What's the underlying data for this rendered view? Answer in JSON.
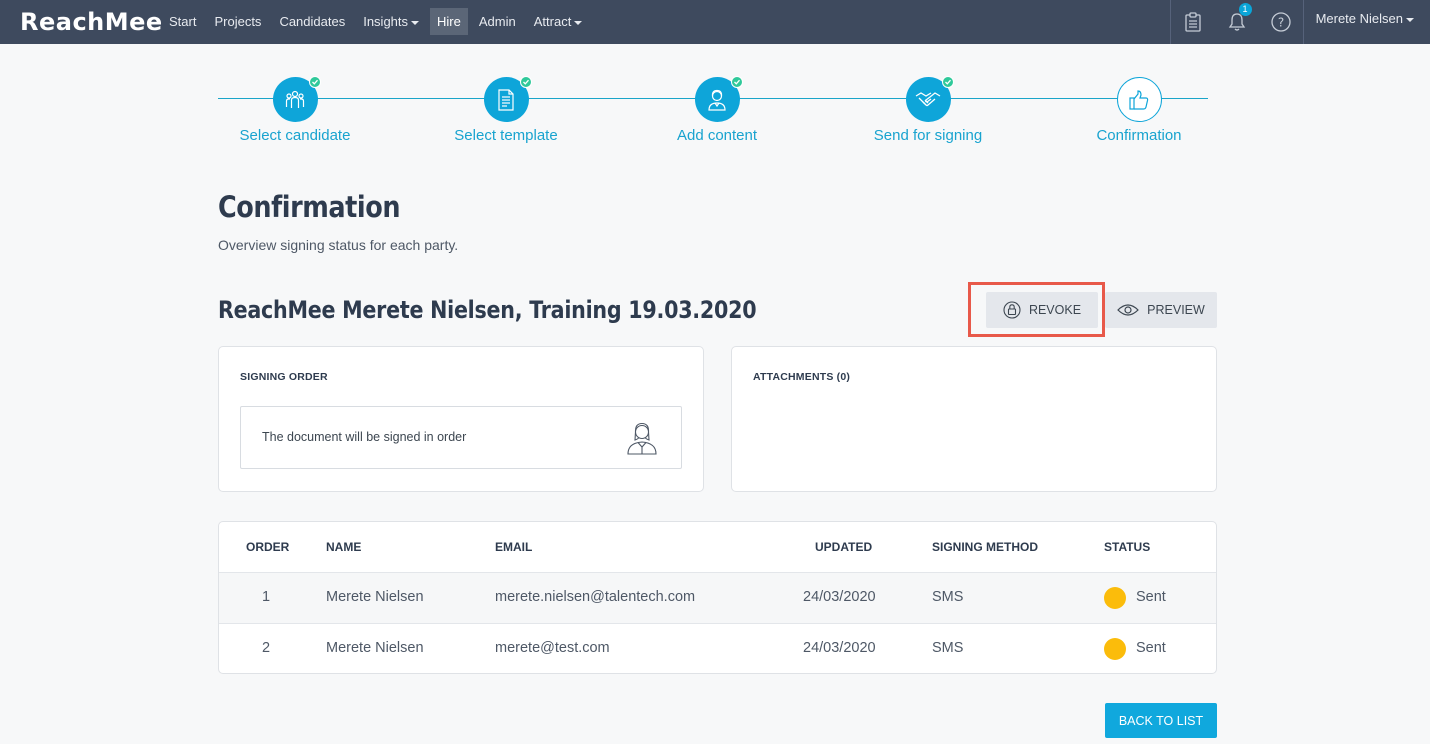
{
  "navbar": {
    "logo": "ReachMee",
    "items": [
      {
        "label": "Start",
        "dropdown": false,
        "active": false
      },
      {
        "label": "Projects",
        "dropdown": false,
        "active": false
      },
      {
        "label": "Candidates",
        "dropdown": false,
        "active": false
      },
      {
        "label": "Insights",
        "dropdown": true,
        "active": false
      },
      {
        "label": "Hire",
        "dropdown": false,
        "active": true
      },
      {
        "label": "Admin",
        "dropdown": false,
        "active": false
      },
      {
        "label": "Attract",
        "dropdown": true,
        "active": false
      }
    ],
    "notification_count": "1",
    "user_name": "Merete Nielsen",
    "icons": [
      "clipboard-icon",
      "bell-icon",
      "help-icon"
    ]
  },
  "stepper": {
    "steps": [
      {
        "label": "Select candidate",
        "icon": "candidates-icon",
        "completed": true
      },
      {
        "label": "Select template",
        "icon": "document-icon",
        "completed": true
      },
      {
        "label": "Add content",
        "icon": "person-icon",
        "completed": true
      },
      {
        "label": "Send for signing",
        "icon": "handshake-icon",
        "completed": true
      },
      {
        "label": "Confirmation",
        "icon": "thumbs-up-icon",
        "completed": false
      }
    ]
  },
  "page": {
    "title": "Confirmation",
    "subtitle": "Overview signing status for each party.",
    "document_title": "ReachMee Merete Nielsen, Training 19.03.2020"
  },
  "actions": {
    "revoke_label": "REVOKE",
    "preview_label": "PREVIEW",
    "back_label": "BACK TO LIST"
  },
  "signing_order": {
    "heading": "SIGNING ORDER",
    "text": "The document will be signed in order"
  },
  "attachments": {
    "heading": "ATTACHMENTS (0)"
  },
  "table": {
    "columns": [
      "ORDER",
      "NAME",
      "EMAIL",
      "UPDATED",
      "SIGNING METHOD",
      "STATUS"
    ],
    "rows": [
      {
        "order": "1",
        "name": "Merete Nielsen",
        "email": "merete.nielsen@talentech.com",
        "updated": "24/03/2020",
        "method": "SMS",
        "status": "Sent"
      },
      {
        "order": "2",
        "name": "Merete Nielsen",
        "email": "merete@test.com",
        "updated": "24/03/2020",
        "method": "SMS",
        "status": "Sent"
      }
    ]
  },
  "colors": {
    "navbar": "#3e4a5e",
    "accent": "#0ea5d9",
    "check": "#2fc99a",
    "status_sent": "#fbbc0b",
    "highlight": "#e8594a"
  }
}
